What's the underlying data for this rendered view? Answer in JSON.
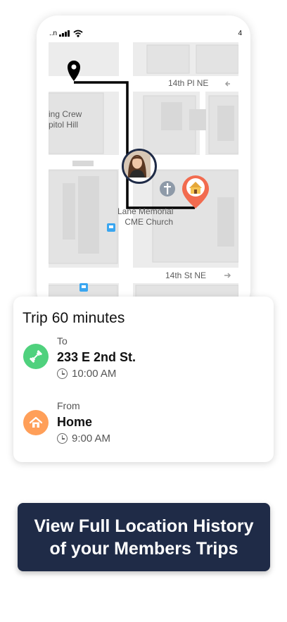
{
  "status_bar": {
    "carrier": "..n",
    "battery": "4"
  },
  "map": {
    "streets": [
      "14th Pl NE",
      "14th St NE"
    ],
    "places": [
      {
        "line1": "ing Crew",
        "line2": "pitol Hill"
      },
      {
        "line1": "Lane Memorial",
        "line2": "CME Church"
      }
    ],
    "colors": {
      "route": "#000000",
      "home_pin": "#f26b4f",
      "road": "#ffffff",
      "block": "#e9e9e9"
    }
  },
  "trip_card": {
    "title": "Trip 60 minutes",
    "to": {
      "caption": "To",
      "place": "233 E 2nd St.",
      "time": "10:00 AM",
      "icon": "dumbbell-icon",
      "color": "#4fd17d"
    },
    "from": {
      "caption": "From",
      "place": "Home",
      "time": "9:00 AM",
      "icon": "home-icon",
      "color": "#ff9f59"
    }
  },
  "cta": {
    "line1": "View Full Location History",
    "line2": "of your Members Trips",
    "color": "#1f2b47"
  }
}
